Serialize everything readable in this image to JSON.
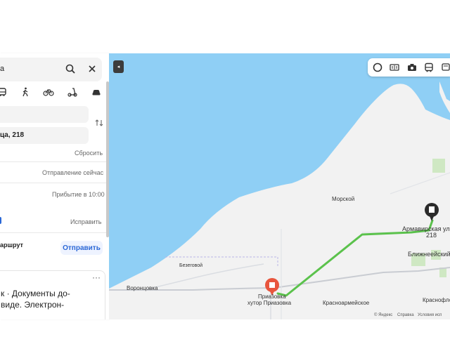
{
  "sidebar": {
    "search_text": "а",
    "modes": [
      "transit",
      "walk",
      "bike",
      "scooter",
      "car"
    ],
    "from_value": "",
    "to_value": "ца, 218",
    "reset_label": "Сбросить",
    "depart_label": "Отправление сейчас",
    "arrival_label": "Прибытие в 10:00",
    "fix_label": "Исправить",
    "share_text": "аршрут",
    "send_label": "Отправить",
    "card_more": "···",
    "card_lines": [
      "к · Документы до-",
      "виде. Электрон-"
    ]
  },
  "map": {
    "collapse_glyph": "◂",
    "layers": [
      "panorama-icon",
      "traffic-icon",
      "camera-icon",
      "bus-icon",
      "transit-icon",
      "more-icon"
    ],
    "places": {
      "morskoy": "Морской",
      "armavirskaya": "Армавирская ул",
      "number": "218",
      "blizhneeysky": "Ближнеейский",
      "bezegovoy": "Безеговой",
      "vorontsovka": "Воронцовка",
      "priazovka": "Приа̃зовка",
      "khutor": "хутор Приазовка",
      "krasnoarmeyskoe": "Красноармейское",
      "krasnoflotsk": "Краснофлот"
    },
    "attribution": [
      "© Яндекс",
      "Справка",
      "Условия исп"
    ],
    "colors": {
      "sea": "#8fcff5",
      "land": "#f2f2f2",
      "route": "#5bc24c",
      "pin_end": "#2b2b2b",
      "pin_start": "#e8553d"
    }
  }
}
